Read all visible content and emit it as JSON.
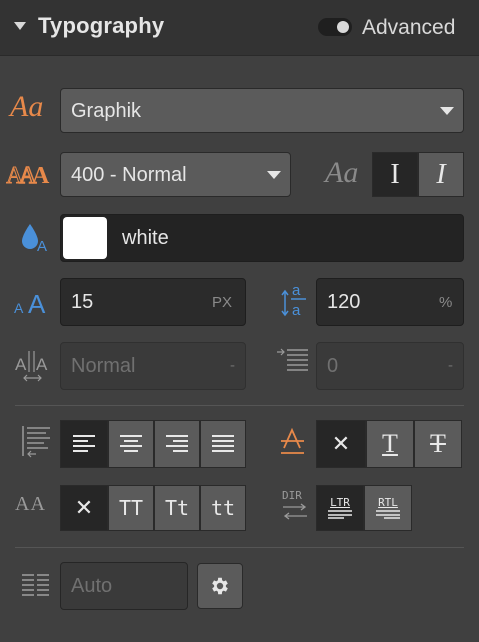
{
  "header": {
    "title": "Typography",
    "advanced_label": "Advanced"
  },
  "font": {
    "family": "Graphik"
  },
  "weight": {
    "value": "400 - Normal",
    "style_preview": "Aa",
    "normal_glyph": "I",
    "italic_glyph": "I"
  },
  "color": {
    "name": "white",
    "swatch": "#ffffff"
  },
  "size": {
    "value": "15",
    "unit": "PX"
  },
  "line_height": {
    "value": "120",
    "unit": "%"
  },
  "letter_spacing": {
    "placeholder": "Normal",
    "unit": "-"
  },
  "text_indent": {
    "placeholder": "0",
    "unit": "-"
  },
  "decoration": {
    "none": "✕",
    "underline": "T",
    "strike": "T"
  },
  "capitalize": {
    "label": "AA",
    "none": "✕",
    "upper": "TT",
    "title": "Tt",
    "lower": "tt"
  },
  "direction": {
    "label": "DIR",
    "ltr": "LTR",
    "rtl": "RTL"
  },
  "columns": {
    "placeholder": "Auto"
  },
  "colors": {
    "accent": "#e8894a",
    "blue": "#4a90d9",
    "panel": "#404040"
  }
}
